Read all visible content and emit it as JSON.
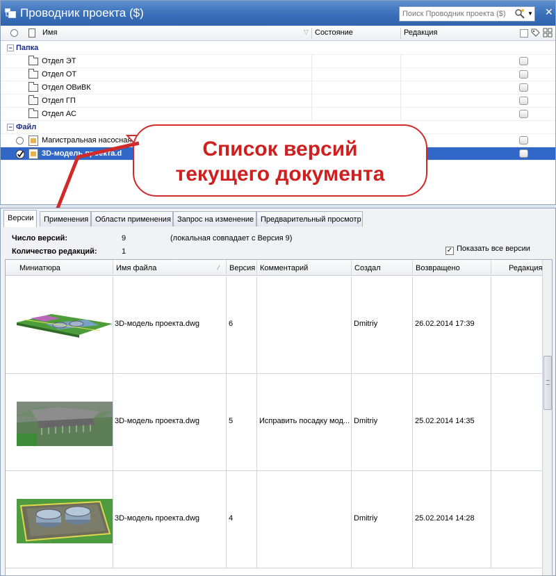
{
  "window": {
    "title": "Проводник проекта ($)",
    "search_placeholder": "Поиск Проводник проекта ($)",
    "close": "✕"
  },
  "tree": {
    "columns": {
      "name": "Имя",
      "state": "Состояние",
      "revision": "Редакция"
    },
    "groups": [
      {
        "label": "Папка",
        "expander": "−"
      },
      {
        "label": "Файл",
        "expander": "−"
      }
    ],
    "folders": [
      "Отдел ЭТ",
      "Отдел ОТ",
      "Отдел ОВиВК",
      "Отдел ГП",
      "Отдел АС"
    ],
    "files": [
      "Магистральная насосная.",
      "3D-модель проекта.d"
    ]
  },
  "callout": {
    "line1": "Список версий",
    "line2": "текущего документа",
    "color": "#d12a2a"
  },
  "tabs": [
    "Версии",
    "Применения",
    "Области применения",
    "Запрос на изменение",
    "Предварительный просмотр"
  ],
  "info": {
    "versions_label": "Число версий:",
    "versions_value": "9",
    "local_note": "(локальная совпадает с Версия 9)",
    "revisions_label": "Количество редакций:",
    "revisions_value": "1",
    "show_all": "Показать все версии",
    "show_all_checked": true
  },
  "grid": {
    "columns": [
      "Миниатюра",
      "Имя файла",
      "Версия",
      "Комментарий",
      "Создал",
      "Возвращено",
      "Редакция"
    ],
    "rows": [
      {
        "file": "3D-модель проекта.dwg",
        "version": "6",
        "comment": "",
        "author": "Dmitriy",
        "returned": "26.02.2014 17:39",
        "revision": ""
      },
      {
        "file": "3D-модель проекта.dwg",
        "version": "5",
        "comment": "Исправить посадку мод...",
        "author": "Dmitriy",
        "returned": "25.02.2014 14:35",
        "revision": ""
      },
      {
        "file": "3D-модель проекта.dwg",
        "version": "4",
        "comment": "",
        "author": "Dmitriy",
        "returned": "25.02.2014 14:28",
        "revision": ""
      }
    ]
  },
  "colors": {
    "titlebar": "#3a70b9",
    "selection": "#3168c7",
    "group_text": "#1a2a8a"
  }
}
